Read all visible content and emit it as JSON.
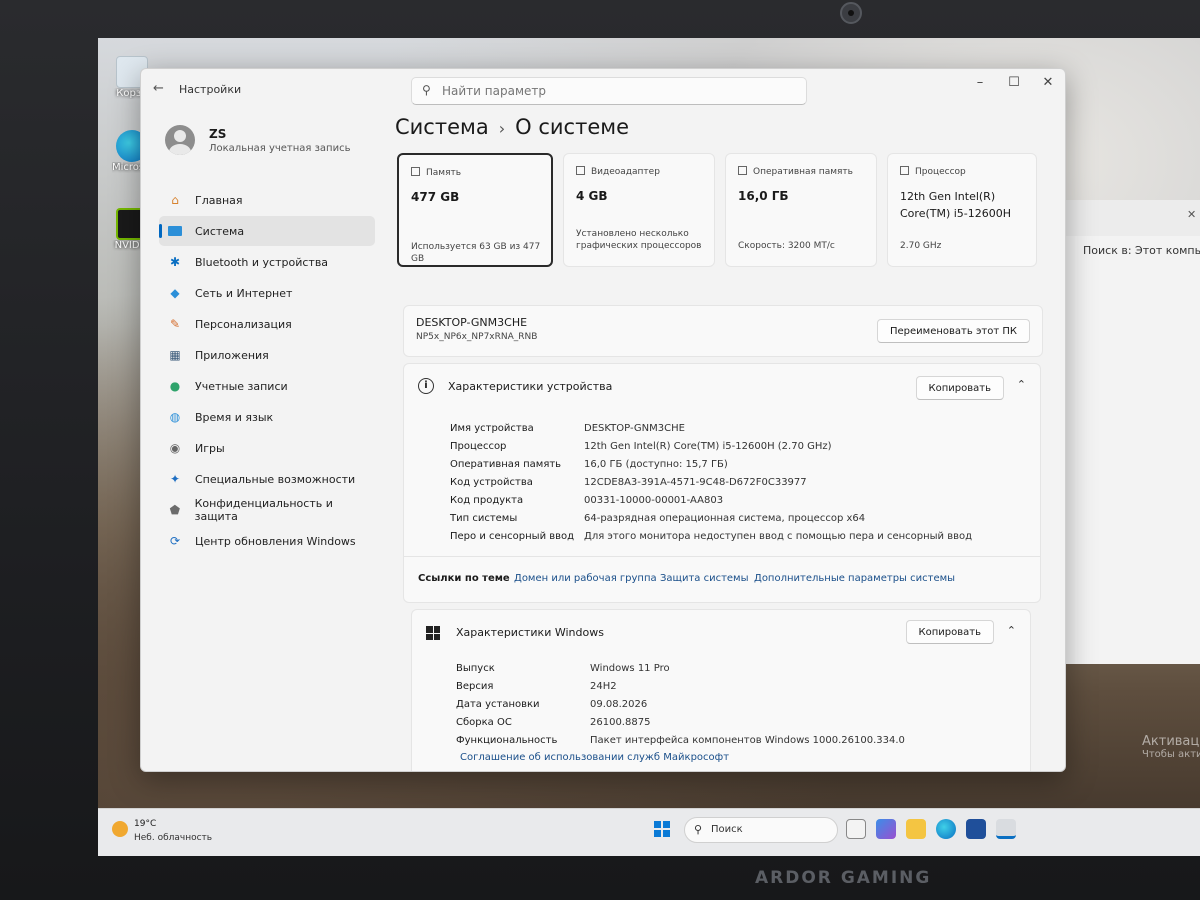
{
  "window": {
    "title": "Настройки",
    "search_placeholder": "Найти параметр"
  },
  "profile": {
    "name": "ZS",
    "subtitle": "Локальная учетная запись"
  },
  "nav": [
    {
      "label": "Главная",
      "icon": "home-icon"
    },
    {
      "label": "Система",
      "icon": "monitor-icon"
    },
    {
      "label": "Bluetooth и устройства",
      "icon": "bluetooth-icon"
    },
    {
      "label": "Сеть и Интернет",
      "icon": "wifi-icon"
    },
    {
      "label": "Персонализация",
      "icon": "brush-icon"
    },
    {
      "label": "Приложения",
      "icon": "apps-icon"
    },
    {
      "label": "Учетные записи",
      "icon": "user-icon"
    },
    {
      "label": "Время и язык",
      "icon": "globe-icon"
    },
    {
      "label": "Игры",
      "icon": "gamepad-icon"
    },
    {
      "label": "Специальные возможности",
      "icon": "accessibility-icon"
    },
    {
      "label": "Конфиденциальность и защита",
      "icon": "shield-icon"
    },
    {
      "label": "Центр обновления Windows",
      "icon": "update-icon"
    }
  ],
  "breadcrumb": {
    "parent": "Система",
    "current": "О системе"
  },
  "cards": [
    {
      "title": "Память",
      "value": "477 GB",
      "sub": "Используется 63 GB из 477 GB"
    },
    {
      "title": "Видеоадаптер",
      "value": "4 GB",
      "sub": "Установлено несколько графических процессоров"
    },
    {
      "title": "Оперативная память",
      "value": "16,0 ГБ",
      "sub": "Скорость: 3200 МТ/с"
    },
    {
      "title": "Процессор",
      "value": "12th Gen Intel(R) Core(TM) i5-12600H",
      "sub": "2.70 GHz"
    }
  ],
  "pc": {
    "name": "DESKTOP-GNM3CHE",
    "model": "NP5x_NP6x_NP7xRNA_RNB",
    "rename_label": "Переименовать этот ПК"
  },
  "device_specs": {
    "title": "Характеристики устройства",
    "copy_label": "Копировать",
    "rows": [
      {
        "k": "Имя устройства",
        "v": "DESKTOP-GNM3CHE"
      },
      {
        "k": "Процессор",
        "v": "12th Gen Intel(R) Core(TM) i5-12600H (2.70 GHz)"
      },
      {
        "k": "Оперативная память",
        "v": "16,0 ГБ (доступно: 15,7 ГБ)"
      },
      {
        "k": "Код устройства",
        "v": "12CDE8A3-391A-4571-9C48-D672F0C33977"
      },
      {
        "k": "Код продукта",
        "v": "00331-10000-00001-AA803"
      },
      {
        "k": "Тип системы",
        "v": "64-разрядная операционная система, процессор x64"
      },
      {
        "k": "Перо и сенсорный ввод",
        "v": "Для этого монитора недоступен ввод с помощью пера и сенсорный ввод"
      }
    ]
  },
  "related_links": {
    "title": "Ссылки по теме",
    "links": [
      "Домен или рабочая группа",
      "Защита системы",
      "Дополнительные параметры системы"
    ]
  },
  "windows_specs": {
    "title": "Характеристики Windows",
    "copy_label": "Копировать",
    "rows": [
      {
        "k": "Выпуск",
        "v": "Windows 11 Pro"
      },
      {
        "k": "Версия",
        "v": "24H2"
      },
      {
        "k": "Дата установки",
        "v": "09.08.2026"
      },
      {
        "k": "Сборка ОС",
        "v": "26100.8875"
      },
      {
        "k": "Функциональность",
        "v": "Пакет интерфейса компонентов Windows 1000.26100.334.0"
      }
    ],
    "ms_link": "Соглашение об использовании служб Майкрософт"
  },
  "desktop": {
    "icons": [
      "Корзи",
      "Micros Edg",
      "NVIDIA"
    ],
    "explorer_search": "Поиск в: Этот компьютер",
    "activation_title": "Активаци",
    "activation_sub": "Чтобы акти"
  },
  "taskbar": {
    "temperature": "19°C",
    "weather": "Неб. облачность",
    "search_label": "Поиск"
  },
  "device_brand": "ARDOR GAMING",
  "colors": {
    "accent": "#0067c0",
    "link": "#1a4f8a"
  }
}
